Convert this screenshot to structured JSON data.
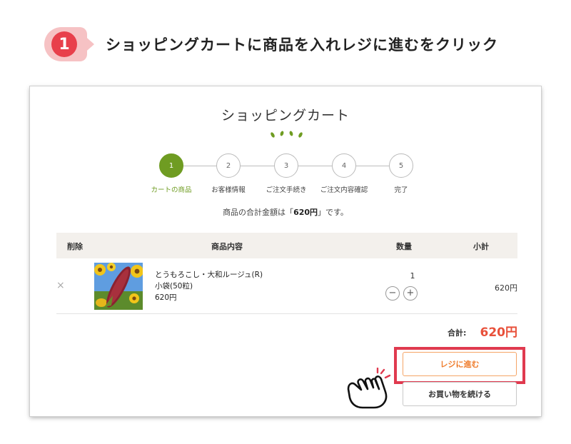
{
  "step": {
    "number": "1",
    "title": "ショッピングカートに商品を入れレジに進むをクリック"
  },
  "cart": {
    "title": "ショッピングカート",
    "progress": [
      {
        "num": "1",
        "label": "カートの商品",
        "active": true
      },
      {
        "num": "2",
        "label": "お客様情報",
        "active": false
      },
      {
        "num": "3",
        "label": "ご注文手続き",
        "active": false
      },
      {
        "num": "4",
        "label": "ご注文内容確認",
        "active": false
      },
      {
        "num": "5",
        "label": "完了",
        "active": false
      }
    ],
    "total_note": {
      "before": "商品の合計金額は「",
      "amount": "620円",
      "after": "」です。"
    },
    "table": {
      "headers": {
        "remove": "削除",
        "content": "商品内容",
        "qty": "数量",
        "subtotal": "小計"
      },
      "items": [
        {
          "remove_icon": "×",
          "name": "とうもろこし・大和ルージュ(R)",
          "variant": "小袋(50粒)",
          "price": "620円",
          "qty": "1",
          "minus": "−",
          "plus": "+",
          "subtotal": "620円"
        }
      ]
    },
    "sum": {
      "label": "合計:",
      "value": "620円"
    },
    "buttons": {
      "checkout": "レジに進む",
      "continue": "お買い物を続ける"
    }
  },
  "colors": {
    "accent_red": "#e83f4b",
    "step_green": "#6f9c22",
    "price_red": "#e8503a",
    "checkout_orange": "#ef7d2d"
  }
}
